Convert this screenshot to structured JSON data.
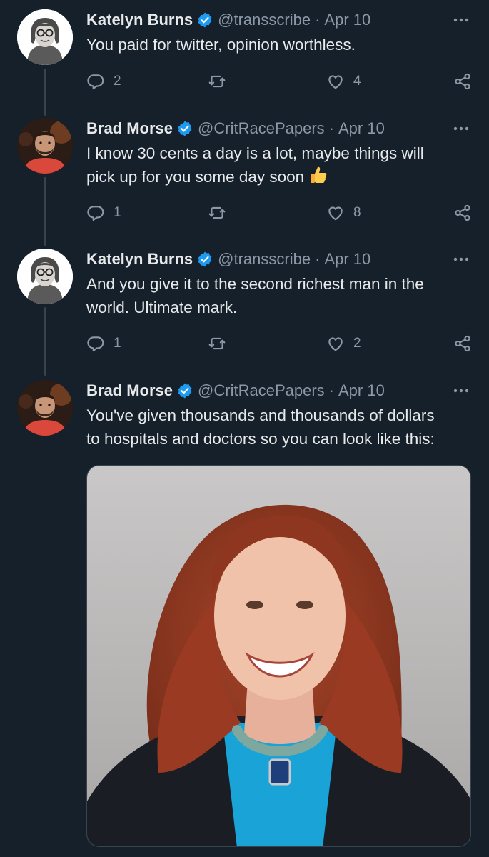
{
  "tweets": [
    {
      "name": "Katelyn Burns",
      "handle": "@transscribe",
      "separator": "·",
      "date": "Apr 10",
      "text": "You paid for twitter, opinion worthless.",
      "replies": "2",
      "retweets": "",
      "likes": "4"
    },
    {
      "name": "Brad Morse",
      "handle": "@CritRacePapers",
      "separator": "·",
      "date": "Apr 10",
      "text_line1": "I know 30 cents a day is a lot, maybe things will",
      "text_line2": "pick up for you some day soon",
      "emoji": "thumbs-up-emoji",
      "replies": "1",
      "retweets": "",
      "likes": "8"
    },
    {
      "name": "Katelyn Burns",
      "handle": "@transscribe",
      "separator": "·",
      "date": "Apr 10",
      "text_line1": "And you give it to the second richest man in the",
      "text_line2": "world. Ultimate mark.",
      "replies": "1",
      "retweets": "",
      "likes": "2"
    },
    {
      "name": "Brad Morse",
      "handle": "@CritRacePapers",
      "separator": "·",
      "date": "Apr 10",
      "text_line1": "You've given thousands and thousands of dollars",
      "text_line2": "to hospitals and doctors so you can look like this:",
      "media": "portrait-photo"
    }
  ],
  "icons": {
    "reply": "reply-icon",
    "retweet": "retweet-icon",
    "like": "heart-icon",
    "share": "share-icon",
    "more": "more-options-icon",
    "verified": "verified-badge-icon"
  },
  "colors": {
    "background": "#15202b",
    "text": "#e7e9ea",
    "secondary": "#8b98a5",
    "verified": "#1d9bf0",
    "thread_line": "#38444d"
  }
}
